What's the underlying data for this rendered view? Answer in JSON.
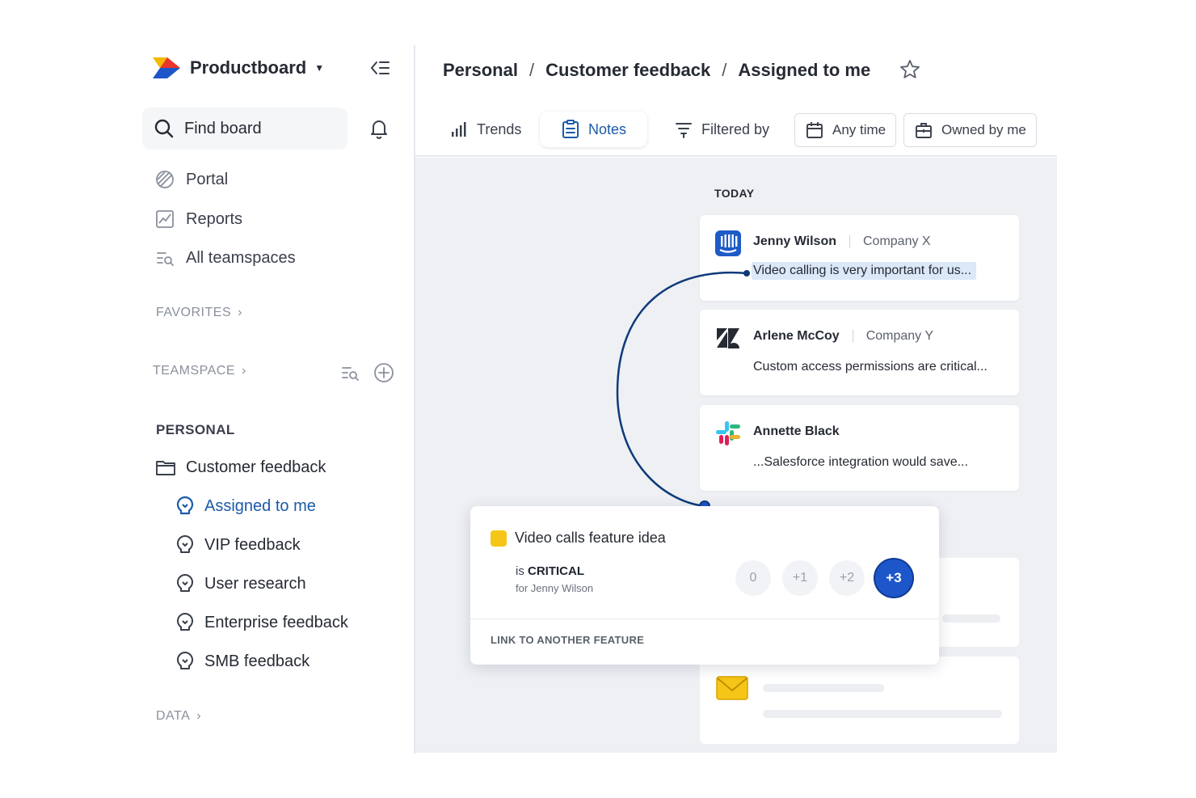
{
  "sidebar": {
    "brand_name": "Productboard",
    "find_board": "Find board",
    "nav": [
      {
        "label": "Portal"
      },
      {
        "label": "Reports"
      },
      {
        "label": "All teamspaces"
      }
    ],
    "favorites_label": "FAVORITES",
    "teamspace_label": "TEAMSPACE",
    "personal_label": "PERSONAL",
    "board_folder": "Customer feedback",
    "boards": [
      {
        "label": "Assigned to me",
        "active": true
      },
      {
        "label": "VIP feedback"
      },
      {
        "label": "User research"
      },
      {
        "label": "Enterprise feedback"
      },
      {
        "label": "SMB feedback"
      }
    ],
    "data_label": "DATA"
  },
  "header": {
    "breadcrumb": [
      "Personal",
      "Customer feedback",
      "Assigned to me"
    ],
    "separator": "/"
  },
  "toolbar": {
    "trends": "Trends",
    "notes": "Notes",
    "filtered_by": "Filtered by",
    "any_time": "Any time",
    "owned_by_me": "Owned by me"
  },
  "feed": {
    "group_label": "TODAY",
    "notes": [
      {
        "name": "Jenny Wilson",
        "company": "Company X",
        "text": "Video calling is very important for us...",
        "source": "intercom-icon"
      },
      {
        "name": "Arlene McCoy",
        "company": "Company Y",
        "text": "Custom access permissions are critical...",
        "source": "zendesk-icon"
      },
      {
        "name": "Annette Black",
        "company": "",
        "text": "...Salesforce integration would save...",
        "source": "slack-icon"
      }
    ]
  },
  "feature_card": {
    "title": "Video calls feature idea",
    "is_prefix": "is",
    "importance": "CRITICAL",
    "for_text": "for Jenny Wilson",
    "scores": [
      "0",
      "+1",
      "+2",
      "+3"
    ],
    "selected_score": "+3",
    "link_label": "LINK TO ANOTHER FEATURE"
  },
  "colors": {
    "accent": "#1b5aa8",
    "selected_score": "#1d56c9",
    "feature_square": "#f5c518",
    "canvas_bg": "#eef0f4"
  }
}
